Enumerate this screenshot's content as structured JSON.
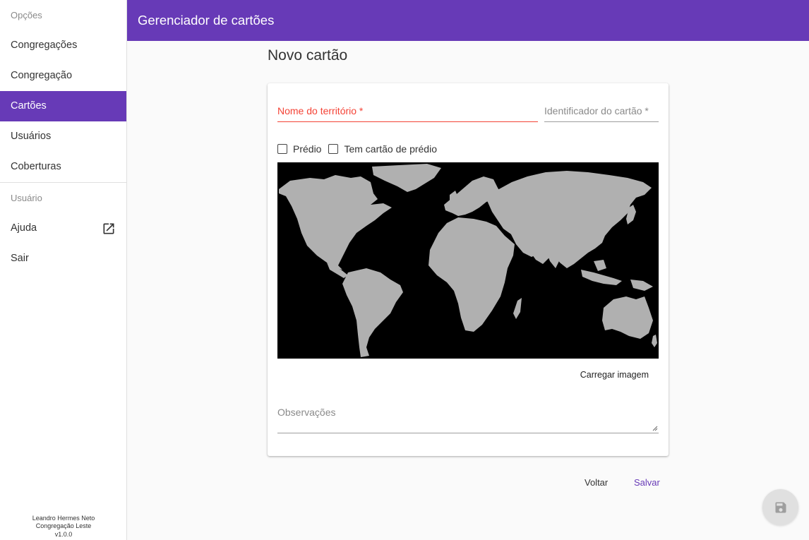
{
  "app": {
    "title": "Gerenciador de cartões"
  },
  "sidebar": {
    "sections": {
      "options": "Opções",
      "user": "Usuário"
    },
    "items": [
      {
        "label": "Congregações",
        "active": false
      },
      {
        "label": "Congregação",
        "active": false
      },
      {
        "label": "Cartões",
        "active": true
      },
      {
        "label": "Usuários",
        "active": false
      },
      {
        "label": "Coberturas",
        "active": false
      }
    ],
    "user_items": [
      {
        "label": "Ajuda",
        "icon": "open-in-new-icon"
      },
      {
        "label": "Sair"
      }
    ],
    "footer": {
      "user_name": "Leandro Hermes Neto",
      "congregation": "Congregação Leste",
      "version": "v1.0.0"
    }
  },
  "page": {
    "title": "Novo cartão",
    "form": {
      "territory_name": {
        "label": "Nome do território *",
        "value": "",
        "state": "error",
        "color": "#f44336"
      },
      "card_id": {
        "label": "Identificador do cartão *",
        "value": ""
      },
      "checkboxes": [
        {
          "label": "Prédio",
          "checked": false
        },
        {
          "label": "Tem cartão de prédio",
          "checked": false
        }
      ],
      "upload_image_label": "Carregar imagem",
      "notes": {
        "label": "Observações",
        "value": ""
      }
    },
    "actions": {
      "back_label": "Voltar",
      "save_label": "Salvar"
    },
    "fab_icon": "save-icon"
  },
  "colors": {
    "primary": "#673ab7",
    "error": "#f44336",
    "map_land": "#b0b0b0",
    "map_sea": "#000000"
  }
}
